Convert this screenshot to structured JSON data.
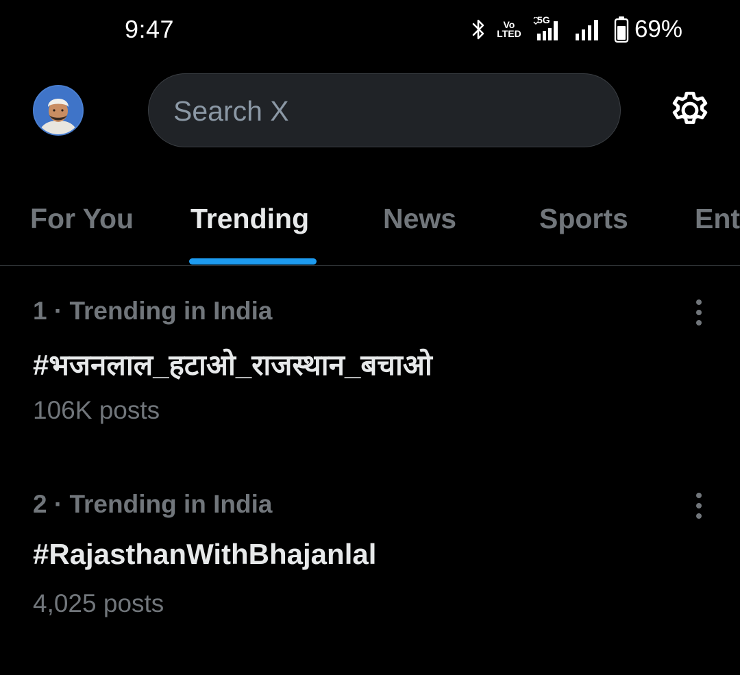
{
  "status_bar": {
    "time": "9:47",
    "volte_top": "Vo",
    "volte_bottom": "LTED",
    "network": "5G",
    "battery": "69%",
    "icons": [
      "bluetooth-icon",
      "volte-icon",
      "signal-5g-icon",
      "signal-icon",
      "battery-icon"
    ]
  },
  "header": {
    "search_placeholder": "Search X",
    "icons": [
      "avatar",
      "gear-icon"
    ]
  },
  "tabs": [
    {
      "label": "For You",
      "active": false
    },
    {
      "label": "Trending",
      "active": true
    },
    {
      "label": "News",
      "active": false
    },
    {
      "label": "Sports",
      "active": false
    },
    {
      "label": "Ent",
      "active": false
    }
  ],
  "trends": [
    {
      "meta": "1 · Trending in India",
      "tag": "#भजनलाल_हटाओ_राजस्थान_बचाओ",
      "count": "106K posts"
    },
    {
      "meta": "2 · Trending in India",
      "tag": "#RajasthanWithBhajanlal",
      "count": "4,025 posts"
    }
  ],
  "colors": {
    "background": "#000000",
    "primary_text": "#e7e9ea",
    "secondary_text": "#71767b",
    "accent": "#1d9bf0",
    "search_bg": "#202327"
  }
}
